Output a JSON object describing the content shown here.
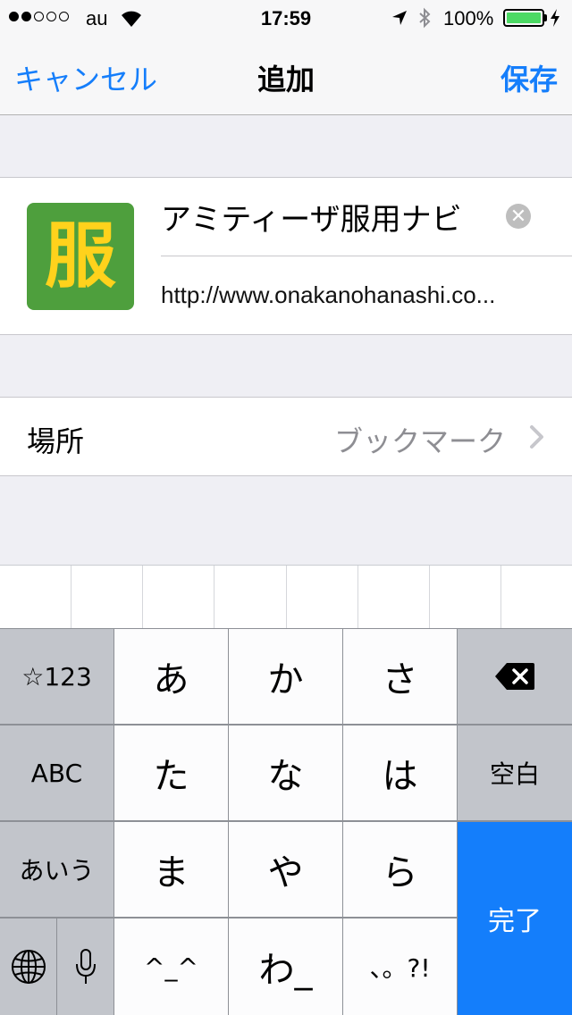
{
  "status_bar": {
    "carrier": "au",
    "time": "17:59",
    "battery_percent": "100%",
    "signal_bars_filled": 2,
    "signal_bars_total": 5,
    "battery_level": 1.0
  },
  "nav": {
    "cancel_label": "キャンセル",
    "title": "追加",
    "save_label": "保存"
  },
  "bookmark": {
    "icon_char": "服",
    "title_value": "アミティーザ服用ナビ",
    "url": "http://www.onakanohanashi.co..."
  },
  "location": {
    "label": "場所",
    "value": "ブックマーク"
  },
  "keyboard": {
    "rows": [
      [
        "☆123",
        "あ",
        "か",
        "さ",
        "⌫"
      ],
      [
        "ABC",
        "た",
        "な",
        "は",
        "空白"
      ],
      [
        "あいう",
        "ま",
        "や",
        "ら",
        "完了"
      ],
      [
        "🌐",
        "🎤",
        "^_^",
        "わ_",
        "、。?!"
      ]
    ],
    "mode_key_label": "☆123",
    "abc_key_label": "ABC",
    "aiu_key_label": "あいう",
    "space_key_label": "空白",
    "done_key_label": "完了",
    "key_a": "あ",
    "key_ka": "か",
    "key_sa": "さ",
    "key_ta": "た",
    "key_na": "な",
    "key_ha": "は",
    "key_ma": "ま",
    "key_ya": "や",
    "key_ra": "ら",
    "key_kaomoji": "^_^",
    "key_wa": "わ_",
    "key_punct": "、。?!"
  },
  "colors": {
    "accent": "#157efb",
    "background": "#efeff4",
    "icon_green": "#4e9f3d",
    "icon_text": "#ffd21c",
    "battery": "#4cd964",
    "done_key": "#147efb"
  },
  "icons": [
    "wifi-icon",
    "location-arrow-icon",
    "bluetooth-icon",
    "battery-icon",
    "charging-bolt-icon",
    "clear-icon",
    "chevron-right-icon",
    "backspace-icon",
    "globe-icon",
    "microphone-icon"
  ]
}
